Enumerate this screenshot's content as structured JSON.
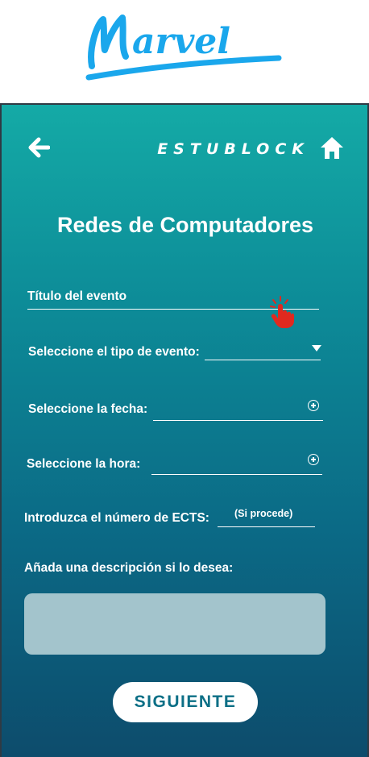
{
  "logo": {
    "text": "Marvel"
  },
  "header": {
    "back_icon": "arrow-left-icon",
    "brand": "ESTUBLOCK",
    "home_icon": "home-icon"
  },
  "title": "Redes de Computadores",
  "form": {
    "event_title": {
      "label": "Título del evento"
    },
    "event_type": {
      "label": "Seleccione el tipo de evento:",
      "icon": "dropdown-arrow-icon"
    },
    "date": {
      "label": "Seleccione la fecha:",
      "icon": "plus-circle-icon"
    },
    "time": {
      "label": "Seleccione la hora:",
      "icon": "plus-circle-icon"
    },
    "ects": {
      "label": "Introduzca el número de ECTS:",
      "hint": "(Si procede)"
    },
    "description": {
      "label": "Añada una descripción si lo desea:"
    }
  },
  "next_button": {
    "label": "SIGUIENTE"
  },
  "colors": {
    "gradient_top": "#14aaa6",
    "gradient_bottom": "#0d4c6c",
    "logo_blue": "#1aa7ec",
    "button_text": "#0c6f86",
    "description_box": "#a3c4cc",
    "cursor_red": "#e0291f"
  }
}
